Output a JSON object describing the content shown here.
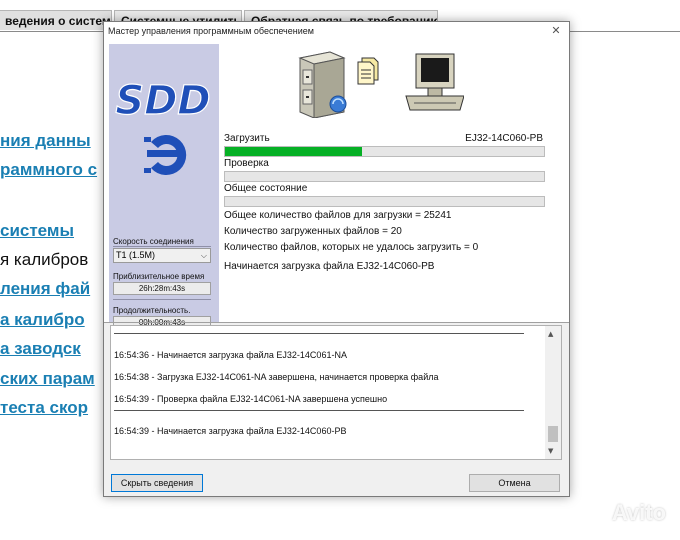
{
  "background_page": {
    "tabs": [
      {
        "label": "ведения о системе"
      },
      {
        "label": "Системные утилиты"
      },
      {
        "label": "Обратная связь по требованию"
      }
    ],
    "links": [
      "ния данны",
      "раммного с",
      "системы",
      "ления фай",
      "а калибро",
      "а заводск",
      "ских парам",
      "теста скор"
    ],
    "plain_text": "я калибров"
  },
  "dialog": {
    "title": "Мастер управления программным обеспечением",
    "close_glyph": "✕",
    "logo_text": "SDD",
    "connection_speed_label": "Скорость соединения",
    "connection_speed_value": "T1 (1.5M)",
    "estimated_time_label": "Приблизительное время",
    "estimated_time_value": "26h:28m:43s",
    "duration_label": "Продолжительность.",
    "duration_value": "00h:00m:43s",
    "download_label": "Загрузить",
    "download_file": "EJ32-14C060-PB",
    "download_progress": 0.43,
    "check_label": "Проверка",
    "check_progress": 0,
    "overall_label": "Общее состояние",
    "overall_progress": 0,
    "stat_total": "Общее количество файлов для загрузки = 25241",
    "stat_loaded": "Количество загруженных файлов = 20",
    "stat_failed": "Количество файлов, которых не удалось загрузить = 0",
    "stat_current": "Начинается загрузка файла EJ32-14C060-PB",
    "log": [
      "16:54:36 - Начинается загрузка файла EJ32-14C061-NA",
      "16:54:38 - Загрузка EJ32-14C061-NA завершена, начинается проверка файла",
      "16:54:39 - Проверка файла EJ32-14C061-NA завершена успешно",
      "16:54:39 - Начинается загрузка файла EJ32-14C060-PB"
    ],
    "hide_button": "Скрыть сведения",
    "cancel_button": "Отмена"
  },
  "watermark": "Avito",
  "colors": {
    "progress": "#06b025",
    "logo": "#1f4fb8",
    "link": "#1a7fb3",
    "left_panel": "#c9cbe4"
  }
}
